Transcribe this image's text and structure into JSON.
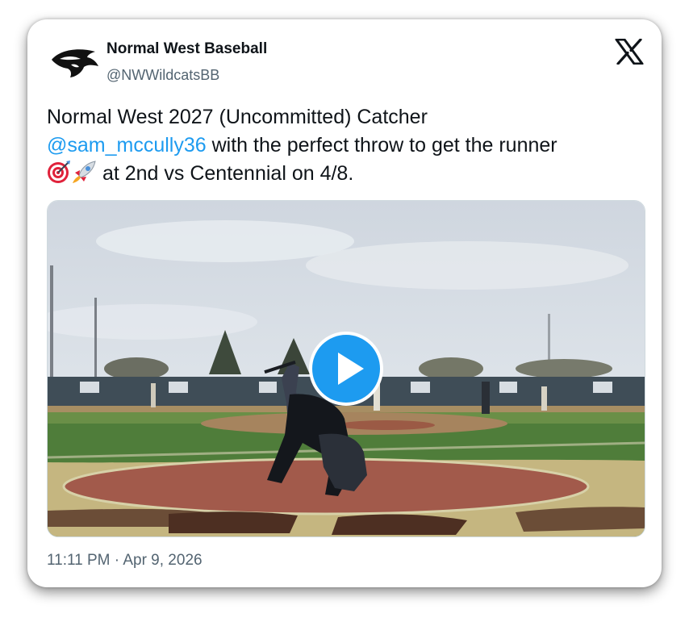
{
  "account": {
    "display_name": "Normal West Baseball",
    "handle": "@NWWildcatsBB",
    "avatar_icon": "wildcat-logo-icon"
  },
  "header": {
    "platform_icon": "x-logo-icon"
  },
  "tweet": {
    "line1": "Normal West 2027 (Uncommitted) Catcher",
    "mention": "@sam_mccully36",
    "line2_rest": " with the perfect throw to get the runner",
    "emojis": [
      "direct-hit-target-icon",
      "rocket-icon"
    ],
    "line3_rest": " at 2nd vs Centennial on 4/8."
  },
  "media": {
    "type": "video",
    "play_icon": "play-icon",
    "scene": "baseball-field-catcher-throw-thumbnail"
  },
  "meta": {
    "timestamp": "11:11 PM · Apr 9, 2026"
  },
  "colors": {
    "link": "#1d9bf0",
    "secondary_text": "#536471",
    "play_button": "#1d9bf0"
  }
}
